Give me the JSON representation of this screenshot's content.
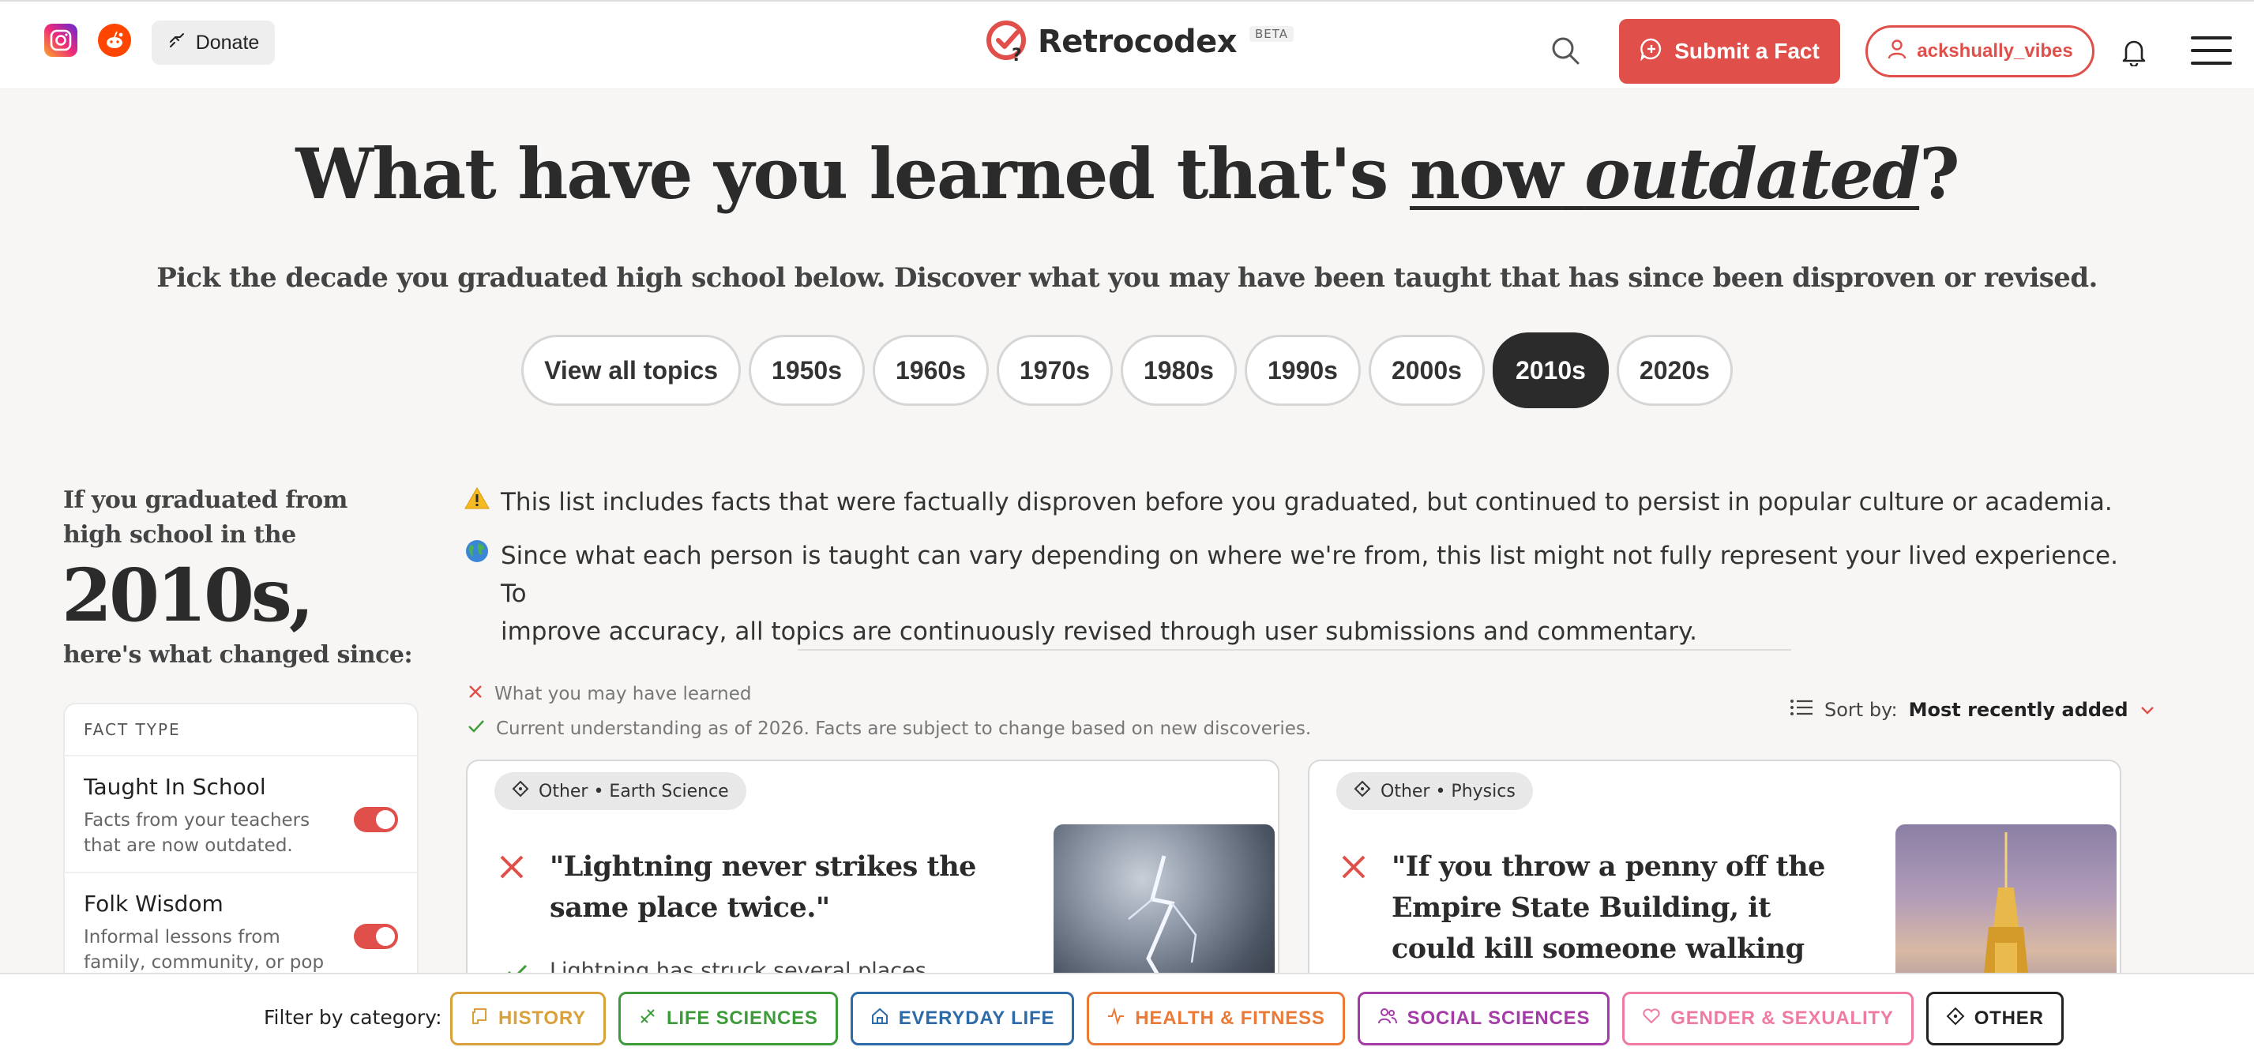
{
  "header": {
    "donate_label": "Donate",
    "logo_text": "Retrocodex",
    "beta_label": "BETA",
    "submit_label": "Submit a Fact",
    "username": "ackshually_vibes",
    "brand_color": "#e04f4a"
  },
  "hero": {
    "title_part1": "What have you learned that's ",
    "title_now": "now",
    "title_outdated": "outdated",
    "title_q": "?",
    "subtitle": "Pick the decade you graduated high school below. Discover what you may have been taught that has since been disproven or revised."
  },
  "decades": {
    "items": [
      "View all topics",
      "1950s",
      "1960s",
      "1970s",
      "1980s",
      "1990s",
      "2000s",
      "2010s",
      "2020s"
    ],
    "selected": "2010s"
  },
  "sidebar": {
    "intro": "If you graduated from high school in the",
    "decade": "2010s,",
    "since": "here's what changed since:",
    "facttype_header": "FACT TYPE",
    "items": [
      {
        "title": "Taught In School",
        "desc": "Facts from your teachers that are now outdated.",
        "enabled": true
      },
      {
        "title": "Folk Wisdom",
        "desc": "Informal lessons from family, community, or pop culture.",
        "enabled": true
      }
    ]
  },
  "notices": {
    "warning": "This list includes facts that were factually disproven before you graduated, but continued to persist in popular culture or academia.",
    "globe_line1": "Since what each person is taught can vary depending on where we're from, this list might not fully represent your lived experience. To",
    "globe_line2": "improve accuracy, all topics are continuously revised through user submissions and commentary."
  },
  "legend": {
    "learned": "What you may have learned",
    "current": "Current understanding as of 2026. Facts are subject to change based on new discoveries."
  },
  "sort": {
    "label": "Sort by:",
    "value": "Most recently added"
  },
  "cards": [
    {
      "tag": "Other • Earth Science",
      "quote": "\"Lightning never strikes the same place twice.\"",
      "answer": "Lightning has struck several places",
      "image": "lightning-storm"
    },
    {
      "tag": "Other • Physics",
      "quote": "\"If you throw a penny off the Empire State Building, it could kill someone walking on the ground",
      "image": "empire-state-building"
    }
  ],
  "filter": {
    "label": "Filter by category:",
    "categories": [
      {
        "label": "HISTORY",
        "color": "#d9a13b"
      },
      {
        "label": "LIFE SCIENCES",
        "color": "#3e9b3a"
      },
      {
        "label": "EVERYDAY LIFE",
        "color": "#2d6aa8"
      },
      {
        "label": "HEALTH & FITNESS",
        "color": "#ea7a35"
      },
      {
        "label": "SOCIAL SCIENCES",
        "color": "#a43ba7"
      },
      {
        "label": "GENDER & SEXUALITY",
        "color": "#ef7aa3"
      },
      {
        "label": "OTHER",
        "color": "#222222"
      }
    ]
  }
}
